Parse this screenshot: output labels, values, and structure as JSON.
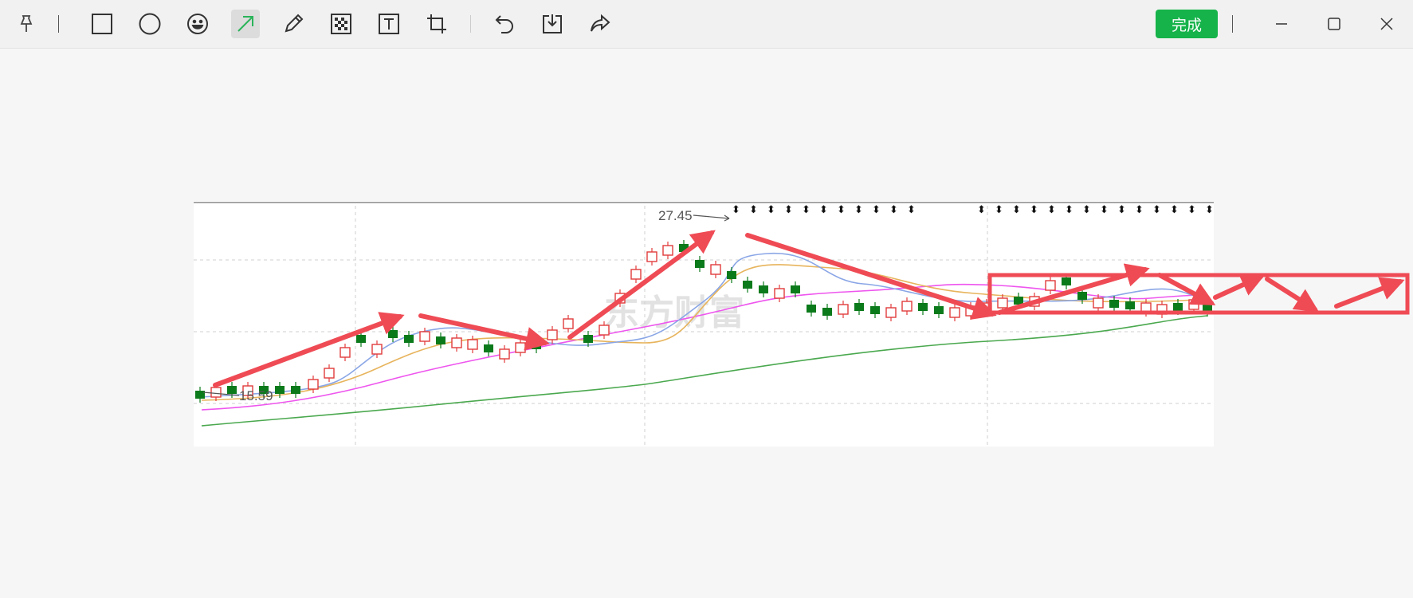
{
  "toolbar": {
    "tools": [
      {
        "name": "pin-icon"
      },
      {
        "name": "rectangle-tool-icon"
      },
      {
        "name": "ellipse-tool-icon"
      },
      {
        "name": "emoji-tool-icon"
      },
      {
        "name": "arrow-tool-icon",
        "active": true
      },
      {
        "name": "pencil-tool-icon"
      },
      {
        "name": "mosaic-tool-icon"
      },
      {
        "name": "text-tool-icon"
      },
      {
        "name": "crop-tool-icon"
      },
      {
        "name": "undo-icon"
      },
      {
        "name": "save-icon"
      },
      {
        "name": "share-icon"
      }
    ],
    "done_label": "完成",
    "done_color": "#16b34a",
    "active_tool_color": "#2bb35a"
  },
  "window": {
    "minimize": "minimize-icon",
    "maximize": "maximize-icon",
    "close": "close-icon"
  },
  "chart": {
    "high_label": "27.45",
    "low_label": "15.59",
    "watermark": "东方财富",
    "annotation_color": "#ef4b55"
  },
  "chart_data": {
    "type": "candlestick",
    "high": 27.45,
    "low": 15.59,
    "series": [
      {
        "name": "",
        "color": "#8aa6e6"
      },
      {
        "name": "",
        "color": "#e7b45c"
      },
      {
        "name": "",
        "color": "#ee55ee"
      },
      {
        "name": "",
        "color": "#4aa84e"
      }
    ],
    "grid": true,
    "up_color": "#e23b3b",
    "down_color": "#0b7a1b"
  }
}
